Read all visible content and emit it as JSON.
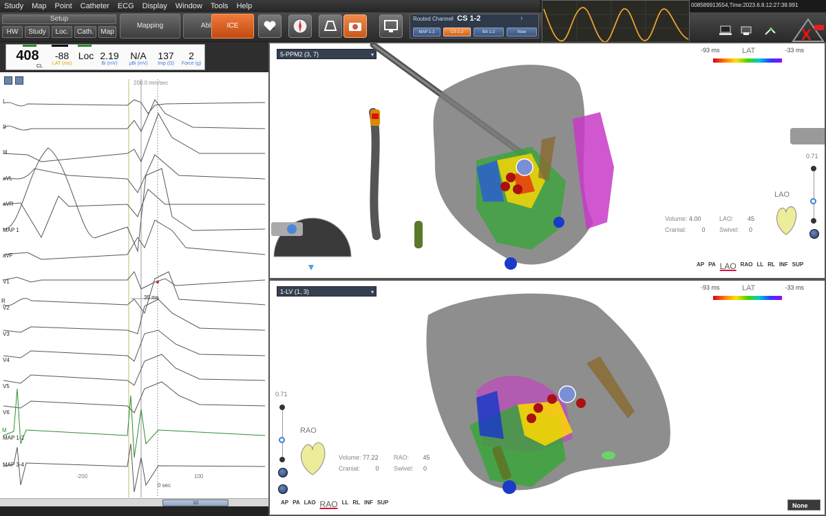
{
  "menu": [
    "Study",
    "Map",
    "Point",
    "Catheter",
    "ECG",
    "Display",
    "Window",
    "Tools",
    "Help"
  ],
  "toolbar": {
    "setup_label": "Setup",
    "setup_buttons": [
      "HW",
      "Study",
      "Loc.",
      "Cath.",
      "Map"
    ],
    "mapping_label": "Mapping",
    "ablation_label": "Ablation",
    "ice_label": "ICE",
    "routed": {
      "title": "Routed Channel",
      "channel": "CS 1-2",
      "chips": [
        "MAP 1-2",
        "CS 1-2",
        "BA 1-2",
        "Now"
      ]
    }
  },
  "status_text": "008589913554,Time:2023.6.8.12:27:38.991",
  "colors": {
    "accent_orange": "#e06a2a",
    "ecg_green": "#2d8c2d",
    "panel_dark": "#2a2a2a"
  },
  "stats": {
    "cl": {
      "value": "408",
      "label": "CL",
      "color": "#111111"
    },
    "lat": {
      "value": "-88",
      "label": "LAT (ms)",
      "color": "#d4a100"
    },
    "loc": {
      "value": "Loc",
      "label": "",
      "color": "#111111"
    },
    "bi": {
      "value": "2.19",
      "label": "Bi (mV)",
      "color": "#3a7ad6"
    },
    "ubi": {
      "value": "N/A",
      "label": "µBi (mV)",
      "color": "#3a7ad6"
    },
    "imp": {
      "value": "137",
      "label": "Imp (Ω)",
      "color": "#3a7ad6"
    },
    "force": {
      "value": "2",
      "label": "Force (g)",
      "color": "#3a7ad6"
    }
  },
  "ecg": {
    "speed": "200.0 mm/sec",
    "channels": [
      "I",
      "II",
      "III",
      "aVL",
      "aVR",
      "MAP 1",
      "aVF",
      "V1",
      "V2",
      "V3",
      "V4",
      "V5",
      "V6",
      "MAP 1-2",
      "MAP 3-4"
    ],
    "side_marks": [
      "R",
      "M"
    ],
    "interval": "35 ms",
    "x_ticks": [
      "-200",
      "100"
    ],
    "zero_label": "0 sec",
    "scroll_label": "10"
  },
  "top_pane": {
    "map_name": "5-PPM2 (3, 7)",
    "lat_low": "-93 ms",
    "lat_title": "LAT",
    "lat_high": "-33 ms",
    "volume_label": "Volume:",
    "volume": "4.00",
    "projection_label": "LAO:",
    "projection_value": "45",
    "cranial_label": "Cranial:",
    "cranial_value": "0",
    "swivel_label": "Swivel:",
    "swivel_value": "0",
    "orientation": "LAO",
    "zoom": "0.71",
    "views": [
      "AP",
      "PA",
      "LAO",
      "RAO",
      "LL",
      "RL",
      "INF",
      "SUP"
    ],
    "selected_view": "LAO"
  },
  "bottom_pane": {
    "map_name": "1-LV (1, 3)",
    "lat_low": "-93 ms",
    "lat_title": "LAT",
    "lat_high": "-33 ms",
    "volume_label": "Volume:",
    "volume": "77.22",
    "projection_label": "RAO:",
    "projection_value": "45",
    "cranial_label": "Cranial:",
    "cranial_value": "0",
    "swivel_label": "Swivel:",
    "swivel_value": "0",
    "orientation": "RAO",
    "zoom": "0.71",
    "views": [
      "AP",
      "PA",
      "LAO",
      "RAO",
      "LL",
      "RL",
      "INF",
      "SUP"
    ],
    "selected_view": "RAO",
    "none_label": "None"
  }
}
